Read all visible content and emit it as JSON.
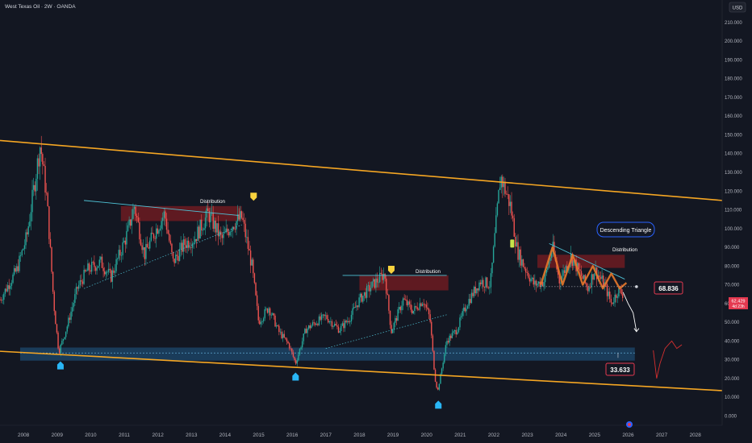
{
  "header": {
    "symbol": "West Texas Oil · 2W · OANDA",
    "currency": "USD"
  },
  "colors": {
    "background": "#131722",
    "up": "#26a69a",
    "down": "#ef5350",
    "channel": "#f5a623",
    "support_zone": "#1e4a6e",
    "supply_zone": "#7a1c22",
    "trendline": "#4fc3d6",
    "triangle": "#e8782a",
    "price_label": "#e53950"
  },
  "chart_data": {
    "type": "candlestick",
    "title": "West Texas Oil · 2W · OANDA",
    "y_ticks": [
      "210.000",
      "200.000",
      "190.000",
      "180.000",
      "170.000",
      "160.000",
      "150.000",
      "140.000",
      "130.000",
      "120.000",
      "110.000",
      "100.000",
      "90.000",
      "80.000",
      "70.000",
      "60.000",
      "50.000",
      "40.000",
      "30.000",
      "20.000",
      "10.000",
      "0.000"
    ],
    "y_tick_values": [
      210,
      200,
      190,
      180,
      170,
      160,
      150,
      140,
      130,
      120,
      110,
      100,
      90,
      80,
      70,
      60,
      50,
      40,
      30,
      20,
      10,
      0
    ],
    "x_ticks": [
      "2008",
      "2009",
      "2010",
      "2011",
      "2012",
      "2013",
      "2014",
      "2015",
      "2016",
      "2017",
      "2018",
      "2019",
      "2020",
      "2021",
      "2022",
      "2023",
      "2024",
      "2025",
      "2026",
      "2027",
      "2028"
    ],
    "x_tick_years": [
      2008,
      2009,
      2010,
      2011,
      2012,
      2013,
      2014,
      2015,
      2016,
      2017,
      2018,
      2019,
      2020,
      2021,
      2022,
      2023,
      2024,
      2025,
      2026,
      2027,
      2028
    ],
    "ylim": [
      -5,
      222
    ],
    "xlim": [
      2007.3,
      2028.8
    ],
    "price_path": [
      [
        2007.3,
        62
      ],
      [
        2007.8,
        78
      ],
      [
        2008.1,
        96
      ],
      [
        2008.5,
        145
      ],
      [
        2008.7,
        115
      ],
      [
        2008.9,
        60
      ],
      [
        2009.05,
        34
      ],
      [
        2009.3,
        48
      ],
      [
        2009.6,
        68
      ],
      [
        2009.9,
        78
      ],
      [
        2010.3,
        82
      ],
      [
        2010.6,
        74
      ],
      [
        2010.9,
        88
      ],
      [
        2011.1,
        98
      ],
      [
        2011.3,
        112
      ],
      [
        2011.6,
        86
      ],
      [
        2011.9,
        98
      ],
      [
        2012.2,
        108
      ],
      [
        2012.45,
        82
      ],
      [
        2012.8,
        92
      ],
      [
        2013.1,
        95
      ],
      [
        2013.5,
        108
      ],
      [
        2013.9,
        94
      ],
      [
        2014.2,
        102
      ],
      [
        2014.5,
        106
      ],
      [
        2014.8,
        80
      ],
      [
        2015.0,
        50
      ],
      [
        2015.3,
        58
      ],
      [
        2015.6,
        45
      ],
      [
        2015.9,
        38
      ],
      [
        2016.1,
        28
      ],
      [
        2016.4,
        46
      ],
      [
        2016.7,
        50
      ],
      [
        2017.0,
        53
      ],
      [
        2017.4,
        46
      ],
      [
        2017.7,
        52
      ],
      [
        2018.0,
        62
      ],
      [
        2018.4,
        70
      ],
      [
        2018.75,
        76
      ],
      [
        2018.95,
        45
      ],
      [
        2019.3,
        62
      ],
      [
        2019.6,
        56
      ],
      [
        2019.9,
        62
      ],
      [
        2020.1,
        52
      ],
      [
        2020.25,
        20
      ],
      [
        2020.33,
        13
      ],
      [
        2020.6,
        40
      ],
      [
        2020.9,
        46
      ],
      [
        2021.2,
        60
      ],
      [
        2021.6,
        72
      ],
      [
        2021.9,
        70
      ],
      [
        2022.2,
        128
      ],
      [
        2022.5,
        112
      ],
      [
        2022.7,
        88
      ],
      [
        2022.9,
        80
      ],
      [
        2023.2,
        70
      ],
      [
        2023.5,
        72
      ],
      [
        2023.75,
        90
      ],
      [
        2023.95,
        72
      ],
      [
        2024.3,
        85
      ],
      [
        2024.6,
        75
      ],
      [
        2024.8,
        68
      ],
      [
        2025.0,
        78
      ],
      [
        2025.3,
        70
      ],
      [
        2025.5,
        60
      ],
      [
        2025.7,
        67
      ],
      [
        2025.85,
        65
      ]
    ],
    "annotations": {
      "distribution_1": "Distribution",
      "distribution_2": "Distribution",
      "distribution_3": "Distribution",
      "descending_triangle": "Descending Triangle",
      "level_high": "68.836",
      "level_low": "33.633",
      "current_price": "62.429",
      "current_time": "4d 23h"
    },
    "channel_upper": [
      [
        2007.3,
        147
      ],
      [
        2028.8,
        115
      ]
    ],
    "channel_lower": [
      [
        2007.3,
        34.5
      ],
      [
        2028.8,
        13.5
      ]
    ],
    "support_zone": [
      29.5,
      36.5
    ],
    "support_dotted": 33.6,
    "resistance_lines": [
      {
        "x1": 2009.8,
        "y1": 115,
        "x2": 2014.4,
        "y2": 107
      },
      {
        "x1": 2017.5,
        "y1": 75,
        "x2": 2020.6,
        "y2": 75
      },
      {
        "x1": 2023.65,
        "y1": 92,
        "x2": 2025.9,
        "y2": 73
      }
    ],
    "support_dotted_lines": [
      {
        "x1": 2009.8,
        "y1": 68,
        "x2": 2014.5,
        "y2": 102
      },
      {
        "x1": 2017.0,
        "y1": 36,
        "x2": 2020.6,
        "y2": 54
      }
    ],
    "supply_zones": [
      {
        "x1": 2010.9,
        "x2": 2014.5,
        "y1": 104,
        "y2": 112
      },
      {
        "x1": 2018.0,
        "x2": 2020.65,
        "y1": 67,
        "y2": 75
      },
      {
        "x1": 2023.3,
        "x2": 2025.9,
        "y1": 79,
        "y2": 86
      }
    ],
    "triangle_path": [
      [
        2023.4,
        70
      ],
      [
        2023.75,
        90
      ],
      [
        2024.05,
        70
      ],
      [
        2024.35,
        86
      ],
      [
        2024.65,
        70
      ],
      [
        2024.95,
        80
      ],
      [
        2025.25,
        68
      ],
      [
        2025.5,
        76
      ],
      [
        2025.75,
        68
      ],
      [
        2025.95,
        71
      ]
    ],
    "triangle_base": 69,
    "projection_path": [
      [
        2025.85,
        66
      ],
      [
        2026.0,
        60
      ],
      [
        2026.15,
        55
      ],
      [
        2026.25,
        45
      ]
    ],
    "future_path": [
      [
        2026.75,
        35
      ],
      [
        2026.85,
        20
      ],
      [
        2026.95,
        28
      ],
      [
        2027.1,
        36
      ],
      [
        2027.3,
        40
      ],
      [
        2027.45,
        36
      ],
      [
        2027.6,
        38
      ]
    ],
    "markers_down": [
      {
        "x": 2014.85,
        "y": 117
      },
      {
        "x": 2018.95,
        "y": 78
      }
    ],
    "markers_up": [
      {
        "x": 2009.1,
        "y": 27
      },
      {
        "x": 2016.1,
        "y": 21
      },
      {
        "x": 2020.35,
        "y": 6
      }
    ],
    "marker_small": {
      "x": 2022.55,
      "y": 92
    }
  }
}
